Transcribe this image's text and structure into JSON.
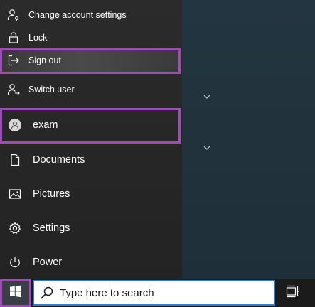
{
  "account_menu": {
    "change_settings": "Change account settings",
    "lock": "Lock",
    "sign_out": "Sign out",
    "switch_user": "Switch user"
  },
  "user": {
    "name": "exam"
  },
  "start_items": {
    "documents": "Documents",
    "pictures": "Pictures",
    "settings": "Settings",
    "power": "Power"
  },
  "taskbar": {
    "search_placeholder": "Type here to search"
  },
  "colors": {
    "highlight": "#9b4fb2",
    "search_border": "#2d7fd3"
  },
  "icons": [
    "user-gear-icon",
    "lock-icon",
    "sign-out-icon",
    "switch-user-icon",
    "avatar-icon",
    "document-icon",
    "pictures-icon",
    "settings-gear-icon",
    "power-icon",
    "windows-logo-icon",
    "search-icon",
    "task-view-icon",
    "chevron-down-icon"
  ]
}
